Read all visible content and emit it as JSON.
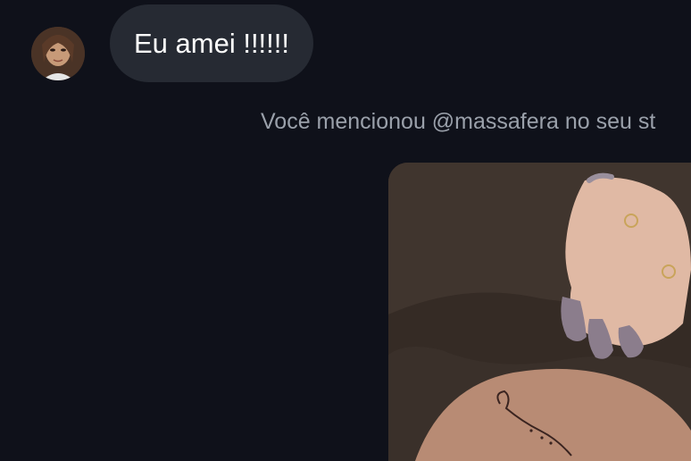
{
  "message": {
    "text": "Eu amei !!!!!!"
  },
  "mention_notice": {
    "text": "Você mencionou @massafera no seu st"
  },
  "icons": {
    "avatar": "user-avatar-photo",
    "story": "story-photo-tattoo"
  },
  "colors": {
    "background": "#0f111a",
    "bubble": "#262a33",
    "muted_text": "#9aa0aa"
  }
}
